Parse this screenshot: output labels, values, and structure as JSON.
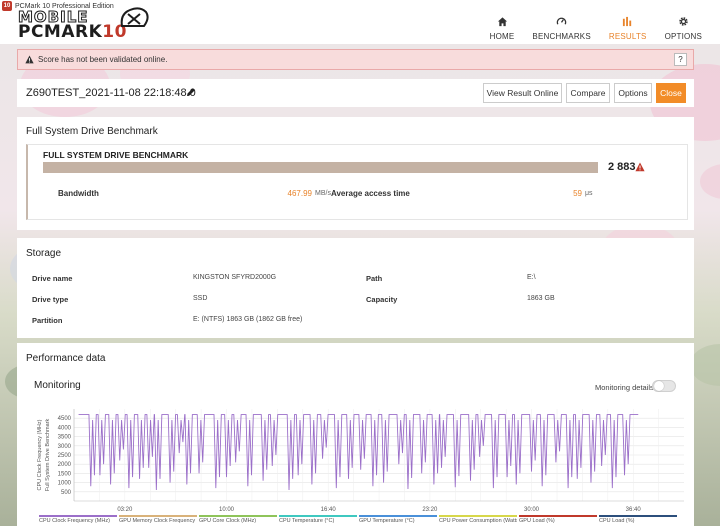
{
  "app": {
    "icon_text": "10",
    "title": "PCMark 10 Professional Edition",
    "logo_top": "MOBILE",
    "logo_main": "PCMARK",
    "logo_num": "10"
  },
  "nav": [
    {
      "label": "HOME",
      "icon": "home-icon",
      "active": false
    },
    {
      "label": "BENCHMARKS",
      "icon": "gauge-icon",
      "active": false
    },
    {
      "label": "RESULTS",
      "icon": "bar-chart-icon",
      "active": true
    },
    {
      "label": "OPTIONS",
      "icon": "gear-icon",
      "active": false
    }
  ],
  "alert": {
    "text": "Score has not been validated online.",
    "help": "?"
  },
  "result": {
    "name": "Z690TEST_2021-11-08 22:18:48.0",
    "buttons": {
      "view": "View Result Online",
      "compare": "Compare",
      "options": "Options",
      "close": "Close"
    }
  },
  "benchmark": {
    "section_title": "Full System Drive Benchmark",
    "title": "FULL SYSTEM DRIVE BENCHMARK",
    "score": "2 883",
    "score_fill": 1.0,
    "bandwidth_label": "Bandwidth",
    "bandwidth_value": "467.99",
    "bandwidth_unit": "MB/s",
    "access_label": "Average access time",
    "access_value": "59",
    "access_unit": "μs"
  },
  "storage": {
    "title": "Storage",
    "drive_name_label": "Drive name",
    "drive_name_value": "KINGSTON SFYRD2000G",
    "path_label": "Path",
    "path_value": "E:\\",
    "drive_type_label": "Drive type",
    "drive_type_value": "SSD",
    "capacity_label": "Capacity",
    "capacity_value": "1863 GB",
    "partition_label": "Partition",
    "partition_value": "E: (NTFS) 1863 GB (1862 GB free)"
  },
  "performance": {
    "title": "Performance data",
    "monitoring_title": "Monitoring",
    "monitoring_details_label": "Monitoring details",
    "monitoring_details_on": false
  },
  "chart_data": {
    "type": "line",
    "ylabel_1": "CPU Clock Frequency (MHz)",
    "ylabel_2": "Full System Drive Benchmark",
    "y_ticks": [
      500,
      1000,
      1500,
      2000,
      2500,
      3000,
      3500,
      4000,
      4500
    ],
    "ylim": [
      0,
      5000
    ],
    "x_ticks": [
      "03:20",
      "10:00",
      "16:40",
      "23:20",
      "30:00",
      "36:40"
    ],
    "x_tick_minutes": [
      3.333,
      10,
      16.667,
      23.333,
      30,
      36.667
    ],
    "xlim_minutes": [
      0,
      40
    ],
    "data_end_minutes": 37,
    "grid": true,
    "series_color": "#9b6fc9",
    "baseline_mhz": 4700,
    "dip_minutes": [
      1.1,
      1.7,
      2.4,
      3.0,
      3.6,
      4.3,
      4.9,
      5.4,
      6.3,
      6.9,
      7.4,
      8.2,
      9.3,
      10.0,
      10.6,
      11.4,
      12.4,
      13.0,
      14.1,
      14.7,
      15.6,
      16.3,
      17.2,
      18.0,
      18.8,
      19.6,
      20.3,
      21.3,
      21.9,
      22.8,
      23.6,
      24.1,
      25.0,
      26.0,
      26.6,
      27.5,
      28.4,
      29.0,
      30.0,
      30.7,
      31.6,
      32.4,
      33.0,
      33.9,
      34.6,
      35.3,
      36.1
    ],
    "dip_mhz": [
      800,
      1400,
      900,
      2200,
      700,
      1200,
      1800,
      600,
      1000,
      2600,
      900,
      1500,
      700,
      1300,
      2100,
      800,
      1100,
      1900,
      600,
      1400,
      900,
      2300,
      700,
      1200,
      1700,
      800,
      1000,
      2000,
      650,
      1500,
      900,
      1800,
      750,
      1100,
      2400,
      700,
      1300,
      900,
      1600,
      800,
      2100,
      700,
      1200,
      1000,
      1900,
      700,
      1400
    ],
    "legend": [
      {
        "name": "CPU Clock Frequency (MHz)",
        "color": "#9b6fc9"
      },
      {
        "name": "GPU Memory Clock Frequency",
        "color": "#d9b27a"
      },
      {
        "name": "GPU Core Clock (MHz)",
        "color": "#8fc45a"
      },
      {
        "name": "CPU Temperature (°C)",
        "color": "#3fc8c0"
      },
      {
        "name": "GPU Temperature (°C)",
        "color": "#4a90d9"
      },
      {
        "name": "CPU Power Consumption (Watts)",
        "color": "#d7d74a"
      },
      {
        "name": "GPU Load (%)",
        "color": "#c0392b"
      },
      {
        "name": "CPU Load (%)",
        "color": "#2c4f7c"
      }
    ]
  }
}
